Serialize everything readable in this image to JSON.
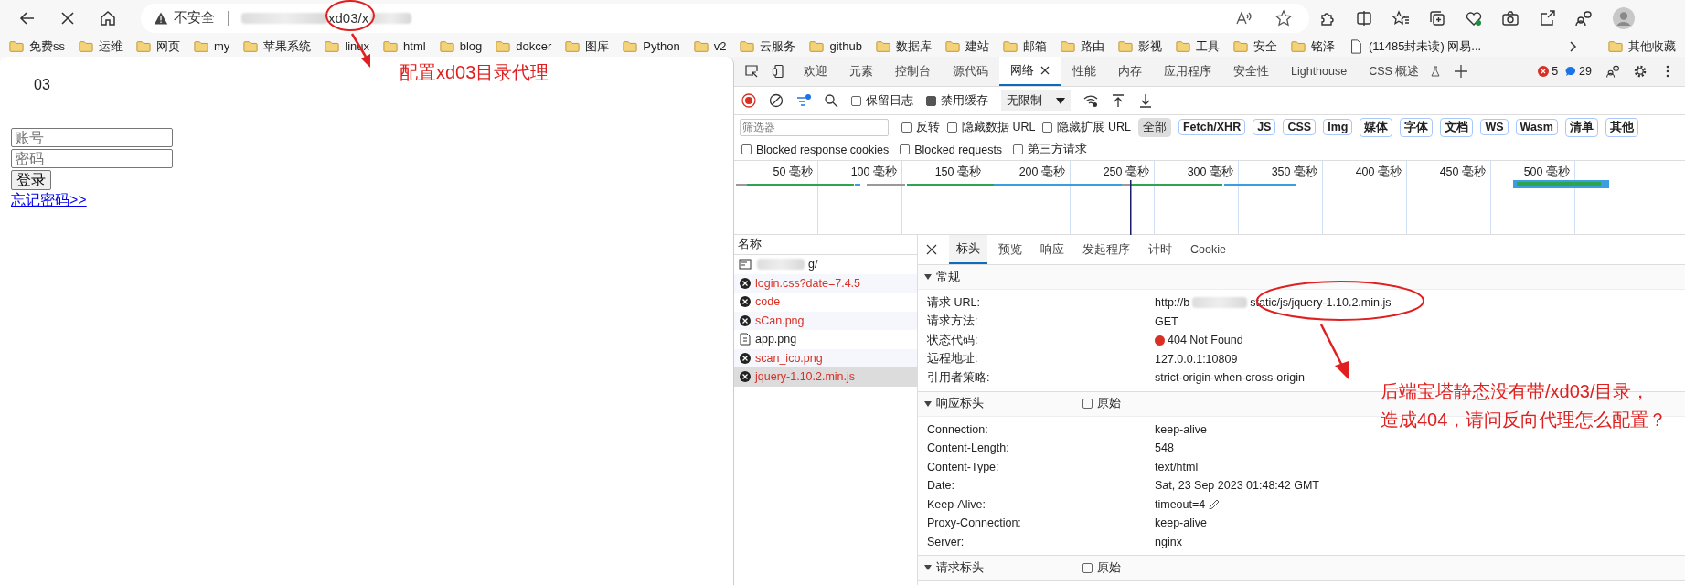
{
  "browser": {
    "security_label": "不安全",
    "address": "xd03/x",
    "bookmarks": [
      {
        "label": "免费ss",
        "kind": "folder"
      },
      {
        "label": "运维",
        "kind": "folder"
      },
      {
        "label": "网页",
        "kind": "folder"
      },
      {
        "label": "my",
        "kind": "folder"
      },
      {
        "label": "苹果系统",
        "kind": "folder"
      },
      {
        "label": "linux",
        "kind": "folder"
      },
      {
        "label": "html",
        "kind": "folder"
      },
      {
        "label": "blog",
        "kind": "folder"
      },
      {
        "label": "dokcer",
        "kind": "folder"
      },
      {
        "label": "图库",
        "kind": "folder"
      },
      {
        "label": "Python",
        "kind": "folder"
      },
      {
        "label": "v2",
        "kind": "folder"
      },
      {
        "label": "云服务",
        "kind": "folder"
      },
      {
        "label": "github",
        "kind": "folder"
      },
      {
        "label": "数据库",
        "kind": "folder"
      },
      {
        "label": "建站",
        "kind": "folder"
      },
      {
        "label": "邮箱",
        "kind": "folder"
      },
      {
        "label": "路由",
        "kind": "folder"
      },
      {
        "label": "影视",
        "kind": "folder"
      },
      {
        "label": "工具",
        "kind": "folder"
      },
      {
        "label": "安全",
        "kind": "folder"
      },
      {
        "label": "铭泽",
        "kind": "folder"
      },
      {
        "label": "(11485封未读) 网易...",
        "kind": "page"
      }
    ],
    "other_bookmarks": "其他收藏"
  },
  "page": {
    "heading": "03",
    "username_placeholder": "账号",
    "password_placeholder": "密码",
    "login_button": "登录",
    "forgot_link": "忘记密码>>"
  },
  "devtools": {
    "tabs": [
      {
        "label": "欢迎",
        "selected": false
      },
      {
        "label": "元素",
        "selected": false
      },
      {
        "label": "控制台",
        "selected": false
      },
      {
        "label": "源代码",
        "selected": false
      },
      {
        "label": "网络",
        "selected": true,
        "closable": true
      },
      {
        "label": "性能",
        "selected": false
      },
      {
        "label": "内存",
        "selected": false
      },
      {
        "label": "应用程序",
        "selected": false
      },
      {
        "label": "安全性",
        "selected": false
      },
      {
        "label": "Lighthouse",
        "selected": false
      },
      {
        "label": "CSS 概述",
        "selected": false
      }
    ],
    "error_count": "5",
    "message_count": "29",
    "preserve_log": {
      "label": "保留日志",
      "checked": false
    },
    "disable_cache": {
      "label": "禁用缓存",
      "checked": true
    },
    "throttling": "无限制",
    "filter_placeholder": "筛选器",
    "filter_options": [
      {
        "label": "反转",
        "checked": false
      },
      {
        "label": "隐藏数据 URL",
        "checked": false
      },
      {
        "label": "隐藏扩展 URL",
        "checked": false
      }
    ],
    "types": [
      {
        "label": "全部",
        "selected": true
      },
      {
        "label": "Fetch/XHR",
        "selected": false
      },
      {
        "label": "JS",
        "selected": false
      },
      {
        "label": "CSS",
        "selected": false
      },
      {
        "label": "Img",
        "selected": false
      },
      {
        "label": "媒体",
        "selected": false
      },
      {
        "label": "字体",
        "selected": false
      },
      {
        "label": "文档",
        "selected": false
      },
      {
        "label": "WS",
        "selected": false
      },
      {
        "label": "Wasm",
        "selected": false
      },
      {
        "label": "清单",
        "selected": false
      },
      {
        "label": "其他",
        "selected": false
      }
    ],
    "extra_options": [
      {
        "label": "Blocked response cookies",
        "checked": false
      },
      {
        "label": "Blocked requests",
        "checked": false
      },
      {
        "label": "第三方请求",
        "checked": false
      }
    ],
    "timeline_ticks": [
      "50 毫秒",
      "100 毫秒",
      "150 毫秒",
      "200 毫秒",
      "250 毫秒",
      "300 毫秒",
      "350 毫秒",
      "400 毫秒",
      "450 毫秒",
      "500 毫秒"
    ],
    "requests_header": "名称",
    "requests": [
      {
        "name": "g/",
        "kind": "document",
        "failed": false,
        "selected": false
      },
      {
        "name": "login.css?date=7.4.5",
        "kind": "error",
        "failed": true,
        "selected": false
      },
      {
        "name": "code",
        "kind": "error",
        "failed": true,
        "selected": false
      },
      {
        "name": "sCan.png",
        "kind": "error",
        "failed": true,
        "selected": false
      },
      {
        "name": "app.png",
        "kind": "file",
        "failed": false,
        "selected": false
      },
      {
        "name": "scan_ico.png",
        "kind": "error",
        "failed": true,
        "selected": false
      },
      {
        "name": "jquery-1.10.2.min.js",
        "kind": "error",
        "failed": true,
        "selected": true
      }
    ],
    "detail_tabs": [
      {
        "label": "标头",
        "selected": true
      },
      {
        "label": "预览",
        "selected": false
      },
      {
        "label": "响应",
        "selected": false
      },
      {
        "label": "发起程序",
        "selected": false
      },
      {
        "label": "计时",
        "selected": false
      },
      {
        "label": "Cookie",
        "selected": false
      }
    ],
    "sections": [
      {
        "title": "常规",
        "rows": [
          {
            "label": "请求 URL:",
            "value": "http://b",
            "value_end": "static/js/jquery-1.10.2.min.js",
            "kind": "redacted"
          },
          {
            "label": "请求方法:",
            "value": "GET",
            "kind": "text"
          },
          {
            "label": "状态代码:",
            "value": "404 Not Found",
            "kind": "status"
          },
          {
            "label": "远程地址:",
            "value": "127.0.0.1:10809",
            "kind": "text"
          },
          {
            "label": "引用者策略:",
            "value": "strict-origin-when-cross-origin",
            "kind": "text"
          }
        ]
      },
      {
        "title": "响应标头",
        "raw_label": "原始",
        "raw_checked": false,
        "rows": [
          {
            "label": "Connection:",
            "value": "keep-alive",
            "kind": "text"
          },
          {
            "label": "Content-Length:",
            "value": "548",
            "kind": "text"
          },
          {
            "label": "Content-Type:",
            "value": "text/html",
            "kind": "text"
          },
          {
            "label": "Date:",
            "value": "Sat, 23 Sep 2023 01:48:42 GMT",
            "kind": "text"
          },
          {
            "label": "Keep-Alive:",
            "value": "timeout=4",
            "kind": "editable"
          },
          {
            "label": "Proxy-Connection:",
            "value": "keep-alive",
            "kind": "text"
          },
          {
            "label": "Server:",
            "value": "nginx",
            "kind": "text"
          }
        ]
      },
      {
        "title": "请求标头",
        "raw_label": "原始",
        "raw_checked": false
      }
    ]
  },
  "annotations": [
    {
      "lines": [
        "配置xd03目录代理"
      ]
    },
    {
      "lines": [
        "后端宝塔静态没有带/xd03/目录，",
        "造成404，请问反向代理怎么配置？"
      ]
    }
  ]
}
